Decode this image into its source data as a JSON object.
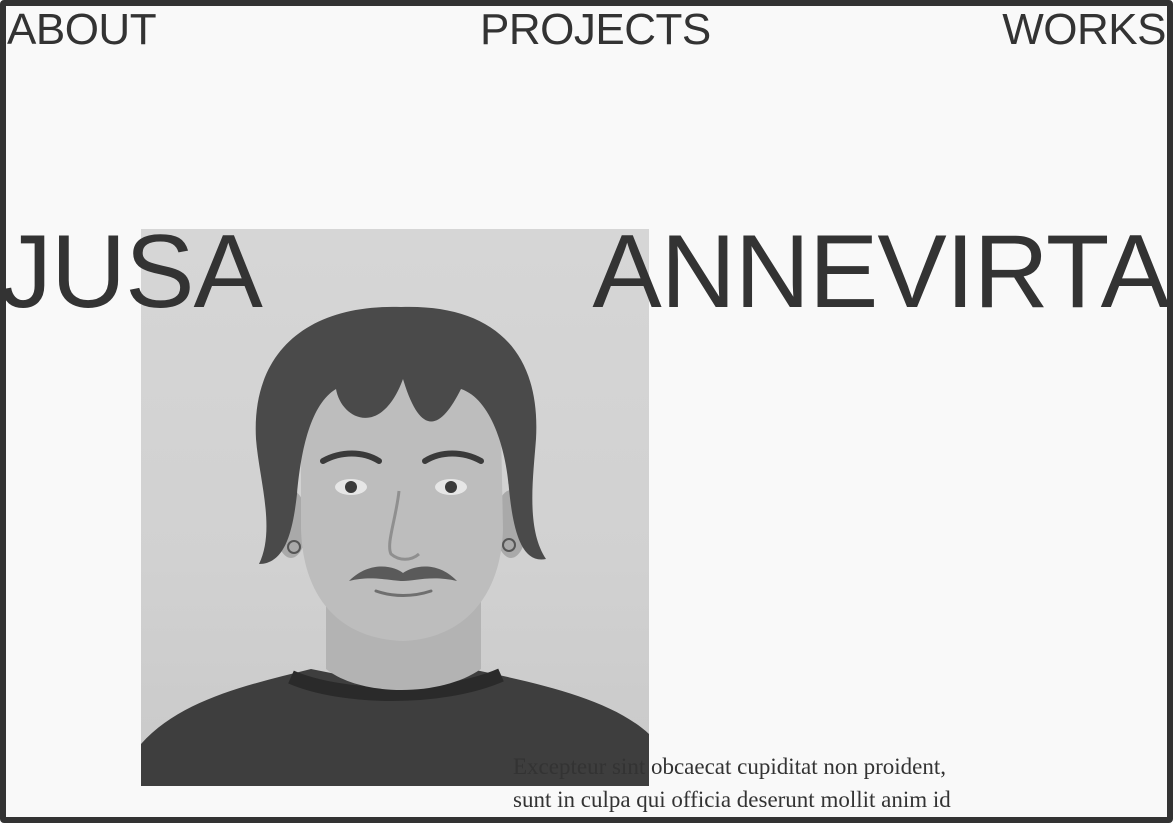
{
  "nav": {
    "about": "ABOUT",
    "projects": "PROJECTS",
    "works": "WORKS"
  },
  "hero": {
    "first_name": "JUSA",
    "last_name": "ANNEVIRTA"
  },
  "bio": {
    "line1": "Excepteur sint obcaecat cupiditat non proident,",
    "line2": "sunt in culpa qui officia deserunt mollit anim id"
  },
  "colors": {
    "text": "#333333",
    "background": "#f9f9f9",
    "frame": "#333333"
  }
}
